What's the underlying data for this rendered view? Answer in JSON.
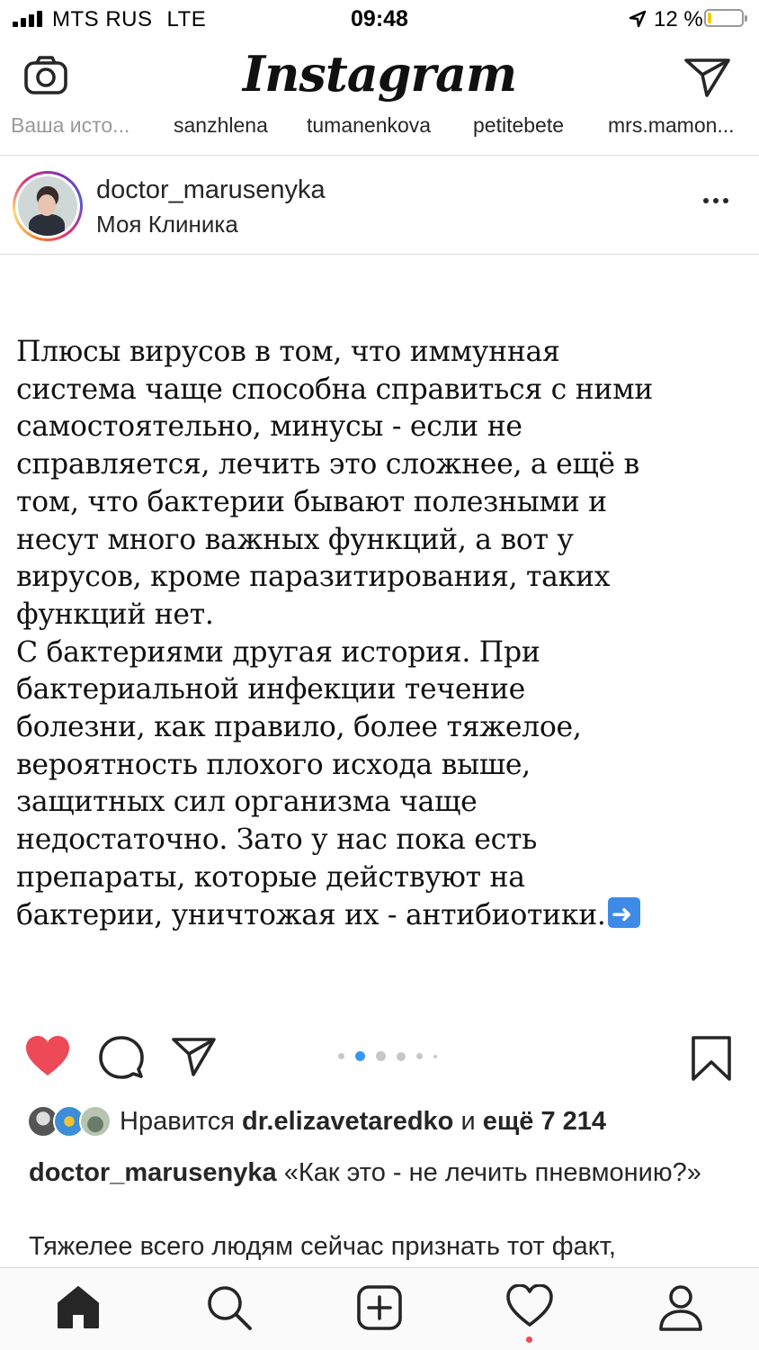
{
  "status_bar": {
    "carrier": "MTS RUS",
    "network": "LTE",
    "time": "09:48",
    "battery_percent": "12 %",
    "battery_level": 0.12,
    "battery_color": "#f2cc00"
  },
  "header": {
    "logo": "Instagram",
    "left_icon": "camera-icon",
    "right_icon": "direct-message-icon"
  },
  "stories": [
    {
      "label": "Ваша исто..."
    },
    {
      "label": "sanzhlena"
    },
    {
      "label": "tumanenkova"
    },
    {
      "label": "petitebete"
    },
    {
      "label": "mrs.mamon..."
    }
  ],
  "post": {
    "username": "doctor_marusenyka",
    "location": "Моя Клиника",
    "image_text": "Плюсы вирусов в том, что иммунная\nсистема чаще способна справиться с ними\nсамостоятельно, минусы - если не\nсправляется, лечить это сложнее, а ещё в\nтом, что бактерии бывают полезными и\nнесут много важных функций, а вот у\nвирусов, кроме паразитирования, таких\nфункций нет.\nС бактериями другая история. При\nбактериальной инфекции течение\nболезни, как правило, более тяжелое,\nвероятность плохого исхода выше,\nзащитных сил организма чаще\nнедостаточно. Зато у нас пока есть\nпрепараты, которые действуют на\nбактерии, уничтожая их - антибиотики.",
    "carousel": {
      "count": 6,
      "active_index": 1
    },
    "liked": true,
    "like_color": "#ed4956",
    "likes": {
      "prefix": "Нравится",
      "user": "dr.elizavetaredko",
      "conj": "и",
      "others": "ещё 7 214"
    },
    "caption": {
      "username": "doctor_marusenyka",
      "text": "«Как это - не лечить пневмонию?»",
      "more": "Тяжелее всего людям сейчас признать тот факт,"
    }
  },
  "tabbar": {
    "items": [
      "home-icon",
      "search-icon",
      "new-post-icon",
      "activity-icon",
      "profile-icon"
    ],
    "notification_color": "#ed4956"
  }
}
